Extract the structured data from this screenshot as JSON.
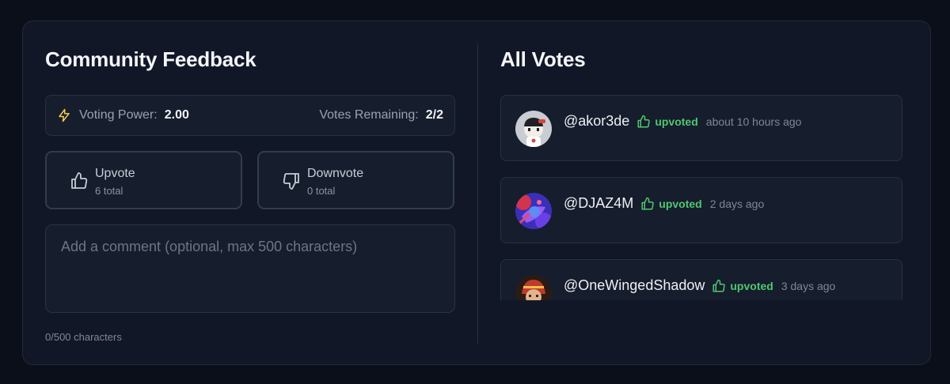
{
  "feedback": {
    "title": "Community Feedback",
    "voting_power_label": "Voting Power:",
    "voting_power_value": "2.00",
    "votes_remaining_label": "Votes Remaining:",
    "votes_remaining_value": "2/2",
    "upvote": {
      "label": "Upvote",
      "total": "6 total"
    },
    "downvote": {
      "label": "Downvote",
      "total": "0 total"
    },
    "comment_placeholder": "Add a comment (optional, max 500 characters)",
    "char_count": "0/500 characters"
  },
  "votes": {
    "title": "All Votes",
    "items": [
      {
        "user": "@akor3de",
        "status": "upvoted",
        "time": "about 10 hours ago",
        "avatar_icon": "avatar-akor3de"
      },
      {
        "user": "@DJAZ4M",
        "status": "upvoted",
        "time": "2 days ago",
        "avatar_icon": "avatar-djaz4m"
      },
      {
        "user": "@OneWingedShadow",
        "status": "upvoted",
        "time": "3 days ago",
        "avatar_icon": "avatar-onewingedshadow"
      }
    ]
  },
  "colors": {
    "background": "#0b0f1a",
    "card": "#111726",
    "upvote_green": "#4fc770",
    "bolt_yellow": "#f2c94c"
  }
}
